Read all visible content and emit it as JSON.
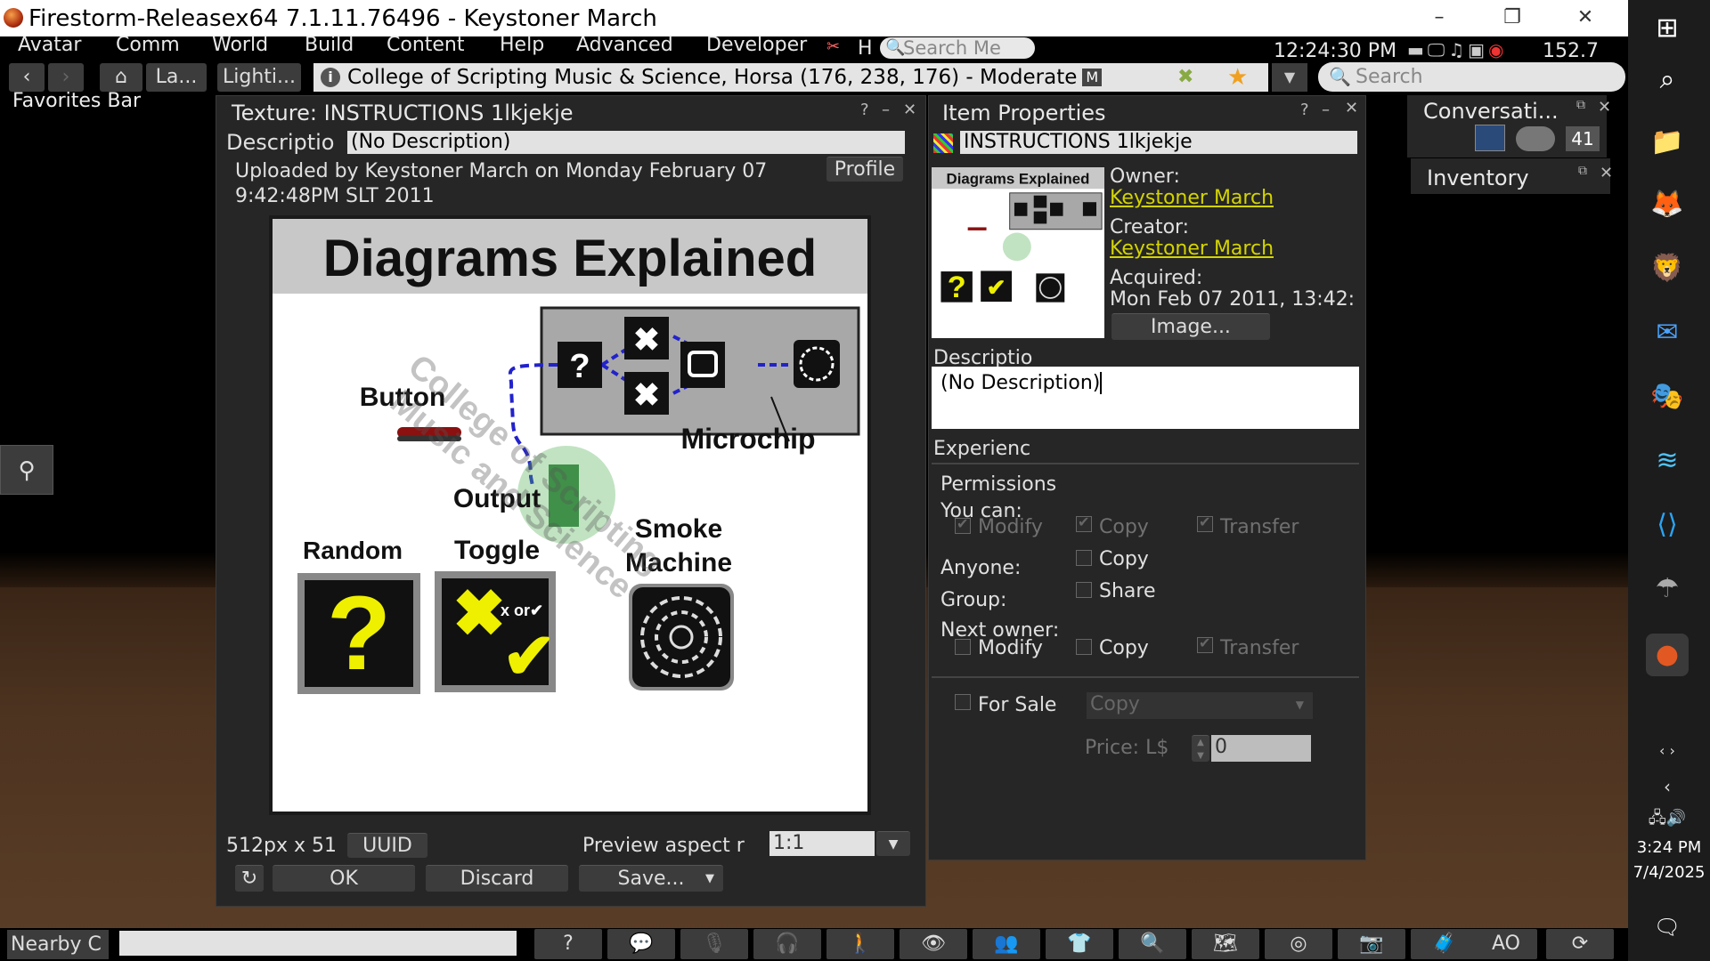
{
  "window": {
    "title": "Firestorm-Releasex64 7.1.11.76496 - Keystoner March",
    "minimize": "–",
    "maximize": "❐",
    "close": "✕"
  },
  "menu": {
    "items": [
      "Avatar",
      "Comm",
      "World",
      "Build",
      "Content",
      "Help",
      "Advanced",
      "Developer"
    ],
    "h_label": "H",
    "search_placeholder": "Search Me",
    "clock": "12:24:30 PM",
    "fps": "152.7"
  },
  "nav": {
    "landmarks": "La...",
    "lighting": "Lighti...",
    "location": "College of Scripting Music & Science, Horsa (176, 238, 176) - Moderate",
    "maturity_badge": "M",
    "search_placeholder": "Search"
  },
  "favorites_bar": "Favorites Bar",
  "texture_floater": {
    "title": "Texture: INSTRUCTIONS 1lkjekje",
    "help": "?",
    "minimize": "–",
    "close": "✕",
    "desc_label": "Descriptio",
    "desc_value": "(No Description)",
    "uploaded_line1": "Uploaded by Keystoner March on Monday February 07",
    "uploaded_line2": "9:42:48PM SLT 2011",
    "profile_button": "Profile",
    "dimensions": "512px x 51",
    "uuid_button": "UUID",
    "preview_aspect_label": "Preview aspect r",
    "preview_aspect_value": "1:1",
    "ok_button": "OK",
    "discard_button": "Discard",
    "save_button": "Save..."
  },
  "diagram": {
    "title": "Diagrams Explained",
    "button": "Button",
    "microchip": "Microchip",
    "output": "Output",
    "smoke_line1": "Smoke",
    "smoke_line2": "Machine",
    "random": "Random",
    "toggle": "Toggle",
    "x_or": "x or✔",
    "watermark1": "College of Scripting",
    "watermark2": "Music and Science"
  },
  "item_properties": {
    "title": "Item Properties",
    "help": "?",
    "minimize": "–",
    "close": "✕",
    "name": "INSTRUCTIONS 1lkjekje",
    "owner_label": "Owner:",
    "owner": "Keystoner March",
    "creator_label": "Creator:",
    "creator": "Keystoner March",
    "acquired_label": "Acquired:",
    "acquired": "Mon Feb 07 2011, 13:42:",
    "image_button": "Image...",
    "desc_label": "Descriptio",
    "desc_value": "(No Description)",
    "experience_label": "Experienc",
    "permissions_label": "Permissions",
    "you_can_label": "You can:",
    "modify": "Modify",
    "copy": "Copy",
    "transfer": "Transfer",
    "anyone_label": "Anyone:",
    "group_label": "Group:",
    "share": "Share",
    "next_owner_label": "Next owner:",
    "for_sale": "For Sale",
    "sale_type": "Copy",
    "price_label": "Price: L$",
    "price_value": "0"
  },
  "conversations": {
    "title": "Conversati...",
    "count": "41"
  },
  "inventory": {
    "title": "Inventory"
  },
  "bottom": {
    "chat_label": "Nearby C",
    "ao_label": "AO"
  },
  "taskbar": {
    "time": "3:24 PM",
    "date": "7/4/2025"
  },
  "colors": {
    "link": "#d4d400",
    "floater_bg": "#262626",
    "output_green": "#4caf50"
  }
}
